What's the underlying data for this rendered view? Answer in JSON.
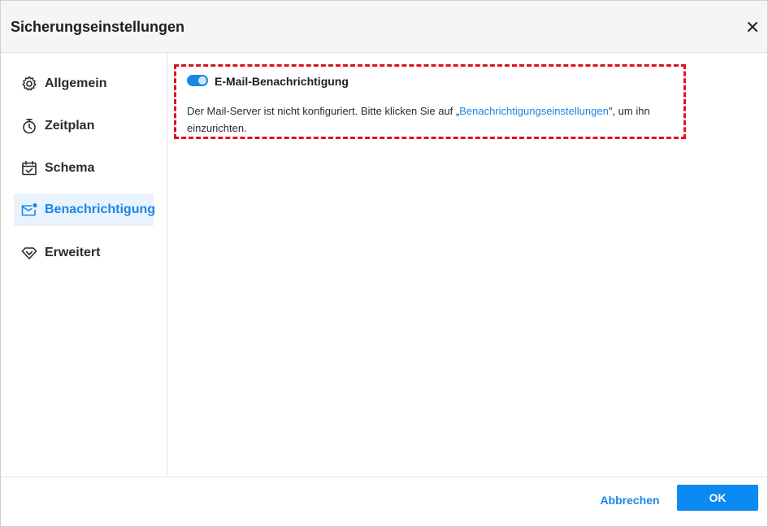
{
  "window": {
    "title": "Sicherungseinstellungen",
    "close_icon": "close-icon"
  },
  "sidebar": {
    "items": [
      {
        "label": "Allgemein",
        "icon": "gear-icon",
        "active": false
      },
      {
        "label": "Zeitplan",
        "icon": "stopwatch-icon",
        "active": false
      },
      {
        "label": "Schema",
        "icon": "calendar-check-icon",
        "active": false
      },
      {
        "label": "Benachrichtigung",
        "icon": "mail-notification-icon",
        "active": true
      },
      {
        "label": "Erweitert",
        "icon": "diamond-icon",
        "active": false
      }
    ]
  },
  "notification": {
    "toggle_on": true,
    "title": "E-Mail-Benachrichtigung",
    "desc_prefix": "Der Mail-Server ist nicht konfiguriert. Bitte klicken Sie auf „",
    "link_text": "Benachrichtigungseinstellungen",
    "desc_suffix": "\", um ihn einzurichten."
  },
  "footer": {
    "cancel_label": "Abbrechen",
    "ok_label": "OK"
  },
  "colors": {
    "accent": "#1a86e6",
    "ok_button": "#0b8af2",
    "highlight_border": "#e0101a",
    "active_bg": "#e8f3fd"
  }
}
